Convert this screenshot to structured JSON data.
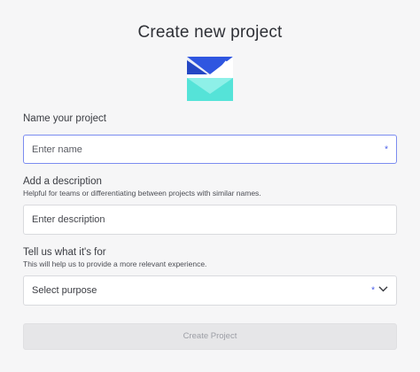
{
  "dialog": {
    "title": "Create new project",
    "name_section": {
      "label": "Name your project",
      "input_placeholder": "Enter name",
      "required_marker": "*"
    },
    "description_section": {
      "label": "Add a description",
      "hint": "Helpful for teams or differentiating between projects with similar names.",
      "input_placeholder": "Enter description"
    },
    "purpose_section": {
      "label": "Tell us what it's for",
      "hint": "This will help us to provide a more relevant experience.",
      "select_value": "Select purpose",
      "required_marker": "*"
    },
    "submit_label": "Create Project"
  },
  "icons": {
    "logo": "project-logo-icon",
    "chevron": "chevron-down-icon"
  },
  "colors": {
    "accent": "#4257e8",
    "logo_blue": "#2f56e0",
    "logo_teal": "#4fe2d6",
    "logo_teal_light": "#7cefe6",
    "disabled_button": "#e6e6e8"
  }
}
